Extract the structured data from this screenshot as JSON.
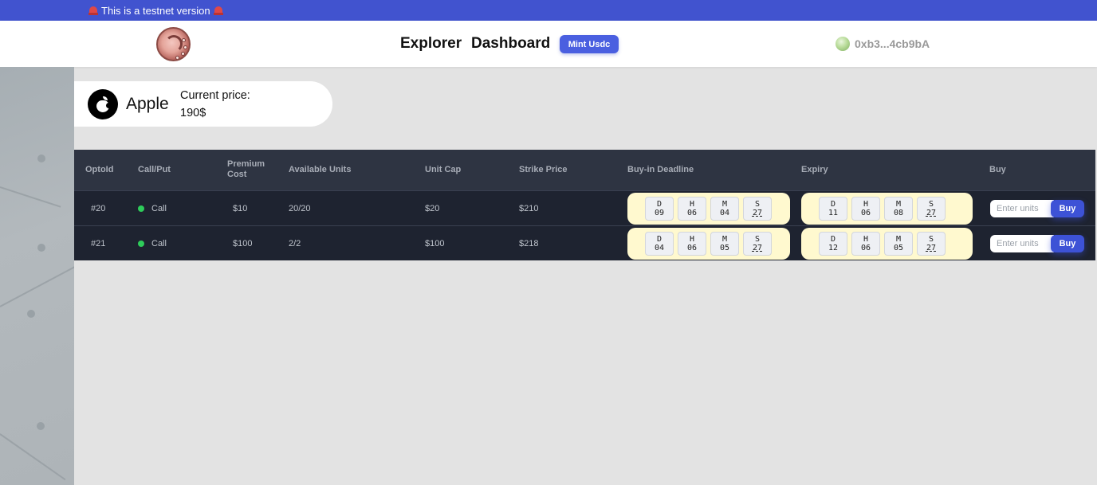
{
  "banner": {
    "text": "This is a testnet version"
  },
  "nav": {
    "explorer": "Explorer",
    "dashboard": "Dashboard",
    "mint_button": "Mint Usdc",
    "wallet_address": "0xb3...4cb9bA"
  },
  "asset": {
    "name": "Apple",
    "price_label": "Current price:",
    "price_value": "190$"
  },
  "table": {
    "headers": {
      "opto_id": "OptoId",
      "call_put": "Call/Put",
      "premium_cost": "Premium Cost",
      "available_units": "Available Units",
      "unit_cap": "Unit Cap",
      "strike_price": "Strike Price",
      "buyin_deadline": "Buy-in Deadline",
      "expiry": "Expiry",
      "buy": "Buy"
    },
    "rows": [
      {
        "opto_id": "#20",
        "type": "Call",
        "premium": "$10",
        "available": "20/20",
        "unit_cap": "$20",
        "strike": "$210",
        "deadline": {
          "d": "09",
          "h": "06",
          "m": "04",
          "s": "27"
        },
        "expiry": {
          "d": "11",
          "h": "06",
          "m": "08",
          "s": "27"
        },
        "input_placeholder": "Enter units",
        "buy_label": "Buy"
      },
      {
        "opto_id": "#21",
        "type": "Call",
        "premium": "$100",
        "available": "2/2",
        "unit_cap": "$100",
        "strike": "$218",
        "deadline": {
          "d": "04",
          "h": "06",
          "m": "05",
          "s": "27"
        },
        "expiry": {
          "d": "12",
          "h": "06",
          "m": "05",
          "s": "27"
        },
        "input_placeholder": "Enter units",
        "buy_label": "Buy"
      }
    ],
    "countdown_labels": {
      "d": "D",
      "h": "H",
      "m": "M",
      "s": "S"
    }
  },
  "colors": {
    "banner": "#4153cf",
    "accent": "#3d52d6",
    "call_status": "#2ecc5a",
    "table_header": "#2e3442",
    "table_row": "#1e2330",
    "countdown_bg": "#fff9cf"
  }
}
